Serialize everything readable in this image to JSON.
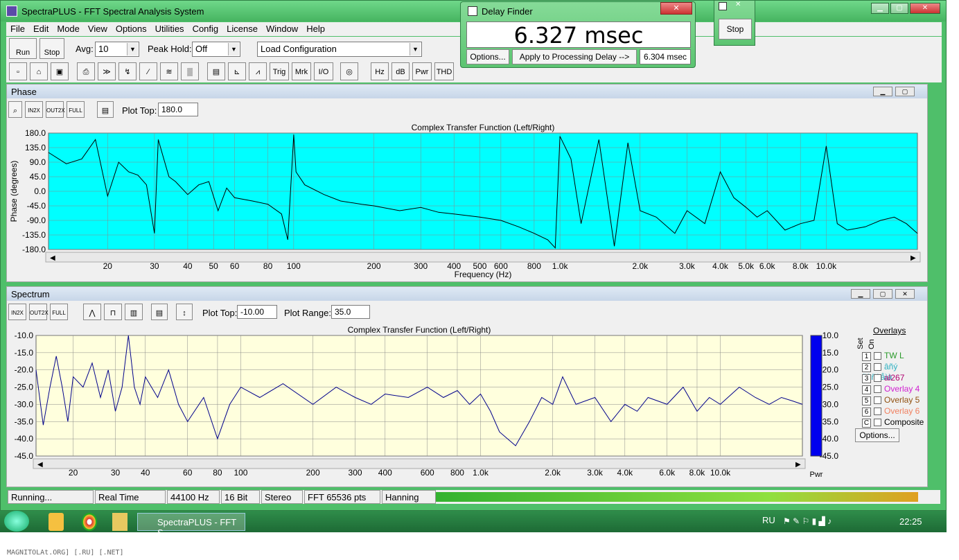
{
  "app": {
    "title": "SpectraPLUS - FFT Spectral Analysis System"
  },
  "menu": [
    "File",
    "Edit",
    "Mode",
    "View",
    "Options",
    "Utilities",
    "Config",
    "License",
    "Window",
    "Help"
  ],
  "toolbar": {
    "run": "Run",
    "stop": "Stop",
    "avg_label": "Avg:",
    "avg_value": "10",
    "peak_label": "Peak Hold:",
    "peak_value": "Off",
    "config_value": "Load Configuration"
  },
  "toolbar2": [
    "Trig",
    "Mrk",
    "I/O",
    "Hz",
    "dB",
    "Pwr",
    "THD"
  ],
  "phase": {
    "title": "Phase",
    "plot_top_label": "Plot Top:",
    "plot_top_value": "180.0",
    "chart_title": "Complex Transfer Function (Left/Right)"
  },
  "spectrum": {
    "title": "Spectrum",
    "plot_top_label": "Plot Top:",
    "plot_top_value": "-10.00",
    "plot_range_label": "Plot Range:",
    "plot_range_value": "35.0",
    "chart_title": "Complex Transfer Function (Left/Right)",
    "pwr": "Pwr"
  },
  "overlays": {
    "title": "Overlays",
    "set": "Set",
    "on": "On",
    "options": "Options...",
    "items": [
      {
        "num": "1",
        "name": "TW L",
        "color": "#2a9a2a"
      },
      {
        "num": "2",
        "name": "âñý ñèñòåìà",
        "color": "#2bb0c0"
      },
      {
        "num": "3",
        "name": "al267",
        "color": "#b00070"
      },
      {
        "num": "4",
        "name": "Overlay 4",
        "color": "#d020d0"
      },
      {
        "num": "5",
        "name": "Overlay 5",
        "color": "#905010"
      },
      {
        "num": "6",
        "name": "Overlay 6",
        "color": "#f08060"
      },
      {
        "num": "C",
        "name": "Composite",
        "color": "#000000"
      }
    ]
  },
  "delay": {
    "title": "Delay Finder",
    "value": "6.327 msec",
    "options": "Options...",
    "apply": "Apply to Processing Delay -->",
    "applied": "6.304 msec"
  },
  "stop_window": {
    "label": "Stop"
  },
  "status": [
    "Running...",
    "Real Time",
    "44100 Hz",
    "16 Bit",
    "Stereo",
    "FFT 65536 pts",
    "Hanning"
  ],
  "taskbar": {
    "app": "SpectraPLUS - FFT S...",
    "lang": "RU",
    "time": "22:25"
  },
  "footer": "MAGNITOLAt.ORG] [.RU] [.NET]",
  "chart_data": [
    {
      "type": "line",
      "title": "Complex Transfer Function (Left/Right)",
      "ylabel": "Phase (degrees)",
      "xlabel": "Frequency (Hz)",
      "ylim": [
        -180,
        180
      ],
      "xlim": [
        12,
        22000
      ],
      "xscale": "log",
      "yticks": [
        "180.0",
        "135.0",
        "90.0",
        "45.0",
        "0.0",
        "-45.0",
        "-90.0",
        "-135.0",
        "-180.0"
      ],
      "xticks": [
        "20",
        "30",
        "40",
        "50",
        "60",
        "80",
        "100",
        "200",
        "300",
        "400",
        "500",
        "600",
        "800",
        "1.0k",
        "2.0k",
        "3.0k",
        "4.0k",
        "5.0k",
        "6.0k",
        "8.0k",
        "10.0k"
      ],
      "background": "#00ffff",
      "x": [
        12,
        14,
        16,
        18,
        20,
        22,
        24,
        26,
        28,
        30,
        31,
        32,
        34,
        36,
        40,
        44,
        48,
        52,
        56,
        60,
        70,
        80,
        90,
        95,
        100,
        102,
        110,
        130,
        150,
        180,
        200,
        250,
        300,
        350,
        400,
        500,
        600,
        700,
        800,
        900,
        960,
        1000,
        1100,
        1200,
        1400,
        1600,
        1800,
        2000,
        2300,
        2700,
        3000,
        3500,
        4000,
        4500,
        5000,
        5500,
        6000,
        7000,
        8000,
        9000,
        10000,
        11000,
        12000,
        14000,
        16000,
        18000,
        20000,
        22000
      ],
      "y": [
        120,
        85,
        100,
        160,
        -15,
        90,
        60,
        50,
        20,
        -130,
        160,
        120,
        45,
        30,
        -10,
        20,
        30,
        -60,
        10,
        -20,
        -30,
        -40,
        -70,
        -150,
        175,
        60,
        20,
        -10,
        -30,
        -40,
        -45,
        -60,
        -50,
        -65,
        -70,
        -80,
        -90,
        -110,
        -130,
        -150,
        -175,
        170,
        100,
        -100,
        160,
        -170,
        150,
        -60,
        -80,
        -130,
        -60,
        -100,
        60,
        -20,
        -50,
        -80,
        -60,
        -120,
        -100,
        -90,
        140,
        -100,
        -120,
        -110,
        -90,
        -80,
        -100,
        -130
      ]
    },
    {
      "type": "line",
      "title": "Complex Transfer Function (Left/Right)",
      "ylabel": "",
      "xlabel": "",
      "ylim": [
        -45,
        -10
      ],
      "xlim": [
        14,
        22000
      ],
      "xscale": "log",
      "yticks": [
        "-10.0",
        "-15.0",
        "-20.0",
        "-25.0",
        "-30.0",
        "-35.0",
        "-40.0",
        "-45.0"
      ],
      "xticks": [
        "20",
        "30",
        "40",
        "60",
        "80",
        "100",
        "200",
        "300",
        "400",
        "600",
        "800",
        "1.0k",
        "2.0k",
        "3.0k",
        "4.0k",
        "6.0k",
        "8.0k",
        "10.0k"
      ],
      "background": "#ffffdd",
      "x": [
        14,
        15,
        16,
        17,
        18,
        19,
        20,
        22,
        24,
        26,
        28,
        30,
        32,
        34,
        36,
        38,
        40,
        45,
        50,
        55,
        60,
        70,
        80,
        90,
        100,
        120,
        150,
        200,
        250,
        300,
        350,
        400,
        500,
        600,
        700,
        800,
        900,
        1000,
        1100,
        1200,
        1400,
        1600,
        1800,
        2000,
        2200,
        2500,
        3000,
        3500,
        4000,
        4500,
        5000,
        6000,
        7000,
        8000,
        9000,
        10000,
        12000,
        14000,
        16000,
        18000,
        20000,
        22000
      ],
      "y": [
        -20,
        -36,
        -25,
        -16,
        -25,
        -35,
        -22,
        -25,
        -18,
        -28,
        -20,
        -32,
        -25,
        -10,
        -25,
        -30,
        -22,
        -28,
        -20,
        -30,
        -35,
        -28,
        -40,
        -30,
        -25,
        -28,
        -24,
        -30,
        -25,
        -28,
        -30,
        -27,
        -28,
        -25,
        -28,
        -26,
        -30,
        -27,
        -32,
        -38,
        -42,
        -35,
        -28,
        -30,
        -22,
        -30,
        -28,
        -35,
        -30,
        -32,
        -28,
        -30,
        -25,
        -32,
        -28,
        -30,
        -25,
        -28,
        -30,
        -28,
        -29,
        -30
      ]
    }
  ]
}
